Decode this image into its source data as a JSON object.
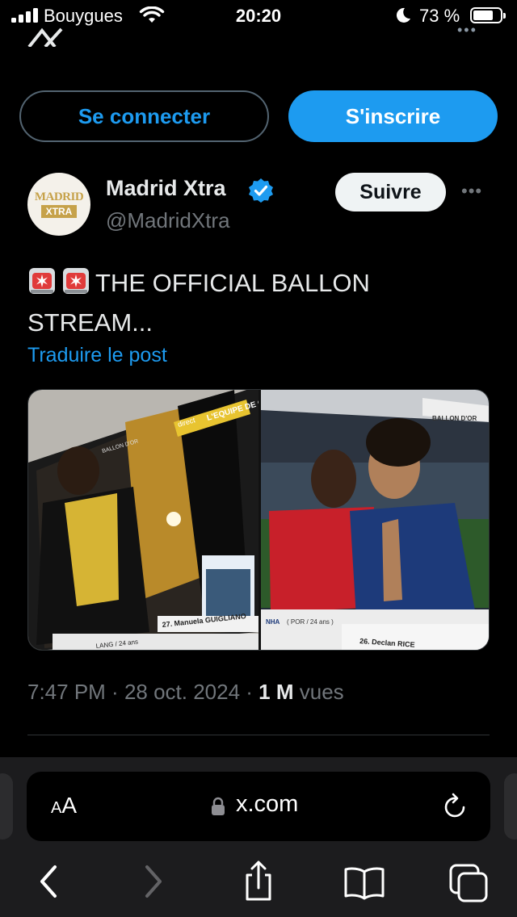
{
  "status_bar": {
    "carrier": "Bouygues",
    "time": "20:20",
    "battery_percent": "73 %",
    "battery_level": 0.73
  },
  "auth": {
    "login_label": "Se connecter",
    "signup_label": "S'inscrire"
  },
  "tweet": {
    "avatar_text_top": "MADRID",
    "avatar_text_bottom": "XTRA",
    "author_name": "Madrid Xtra",
    "author_handle": "@MadridXtra",
    "follow_label": "Suivre",
    "text": "THE OFFICIAL BALLON STREAM...",
    "emojis": [
      "siren-icon",
      "siren-icon"
    ],
    "translate_label": "Traduire le post",
    "media": {
      "left": {
        "overlay_channel": "L'EQUIPE DE GREG",
        "overlay_direct": "direct",
        "overlay_ballon": "BALLON D'OR",
        "caption": "27. Manuela GUIGLIANO",
        "caption_bottom": "LANG / 24 ans"
      },
      "right": {
        "overlay_ballon": "BALLON D'OR",
        "caption_left": "( POR / 24 ans )",
        "caption_right": "26. Declan RICE",
        "prefix": "NHA"
      }
    },
    "time": "7:47 PM",
    "date": "28 oct. 2024",
    "views_count": "1 M",
    "views_label": "vues"
  },
  "browser": {
    "aa_label": "AA",
    "url": "x.com",
    "icons": [
      "back-icon",
      "forward-icon",
      "share-icon",
      "bookmarks-icon",
      "tabs-icon"
    ]
  },
  "colors": {
    "accent": "#1d9bf0",
    "background": "#000000",
    "muted": "#71767b",
    "safari_bar": "#1c1c1e"
  }
}
